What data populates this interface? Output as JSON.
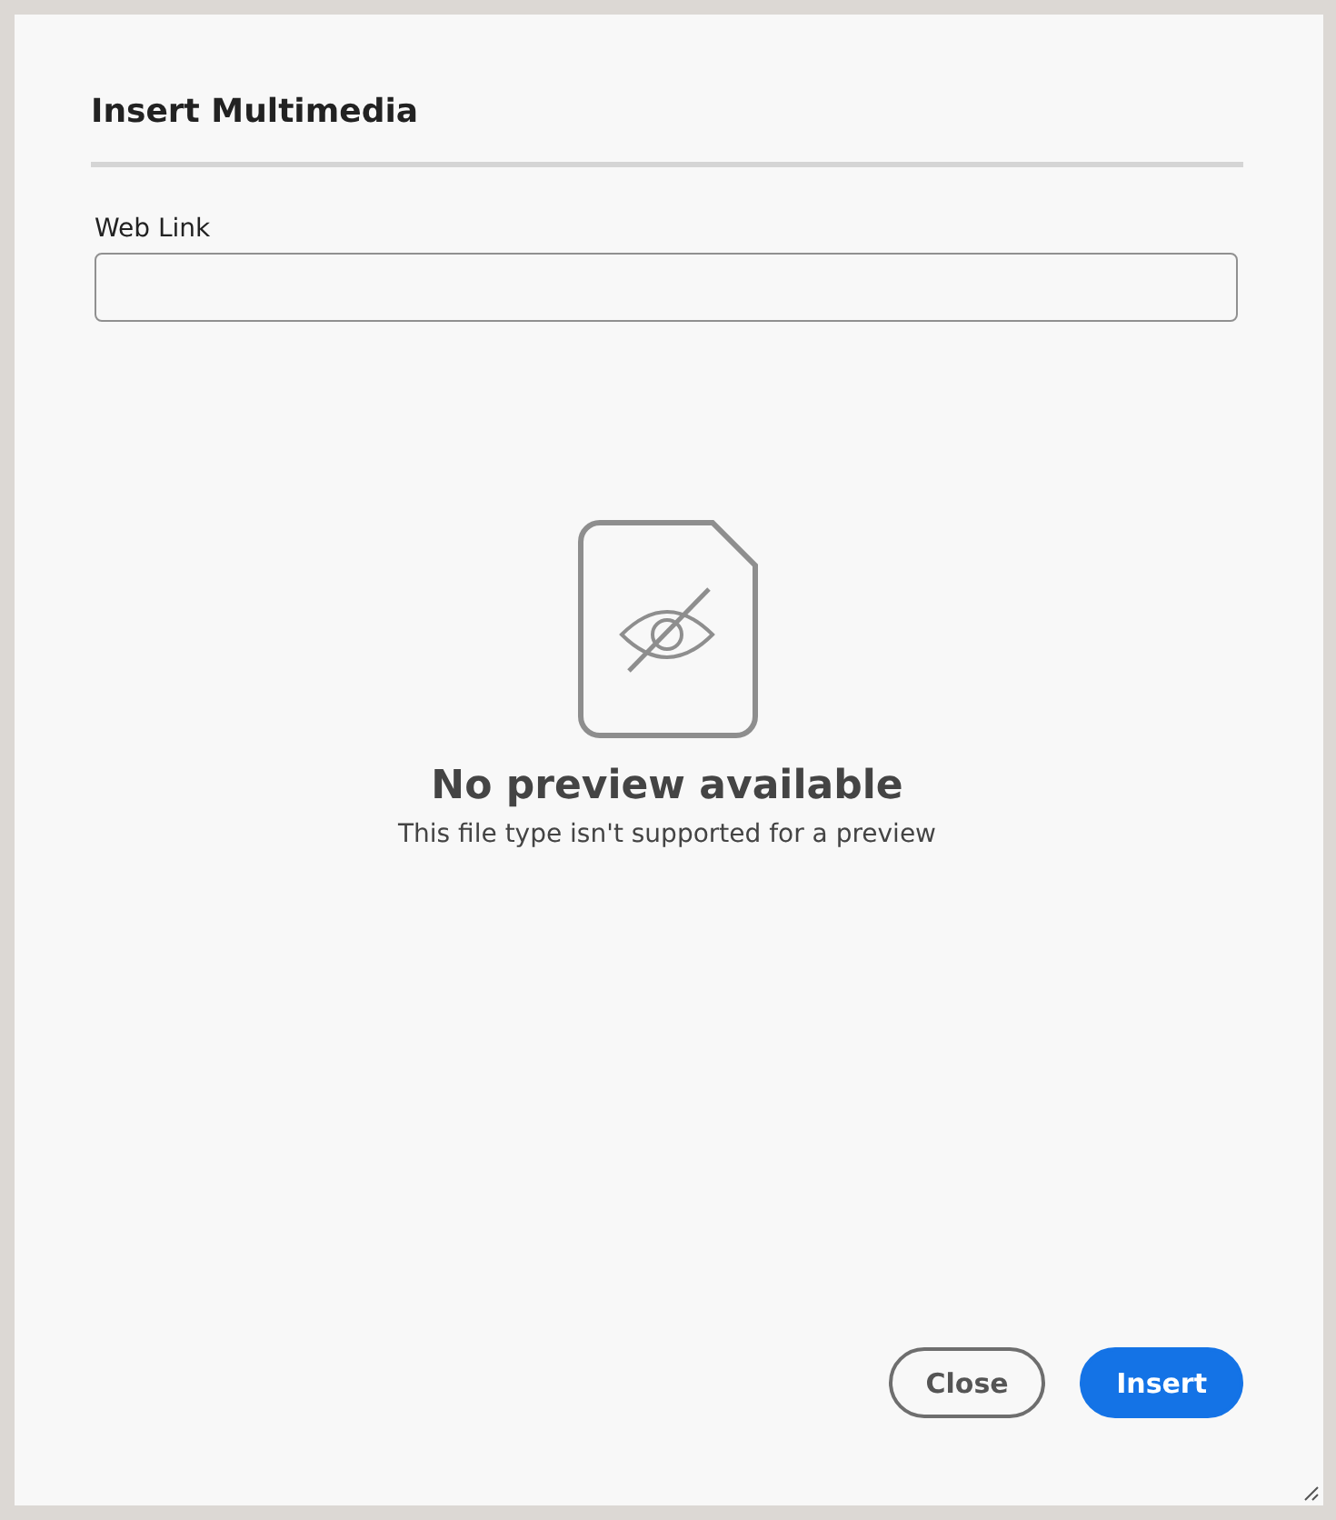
{
  "dialog": {
    "title": "Insert Multimedia"
  },
  "web_link": {
    "label": "Web Link"
  },
  "preview": {
    "heading": "No preview available",
    "message": "This file type isn't supported for a preview"
  },
  "buttons": [
    {
      "label": "Close",
      "kind": "secondary"
    },
    {
      "label": "Insert",
      "kind": "primary"
    }
  ]
}
